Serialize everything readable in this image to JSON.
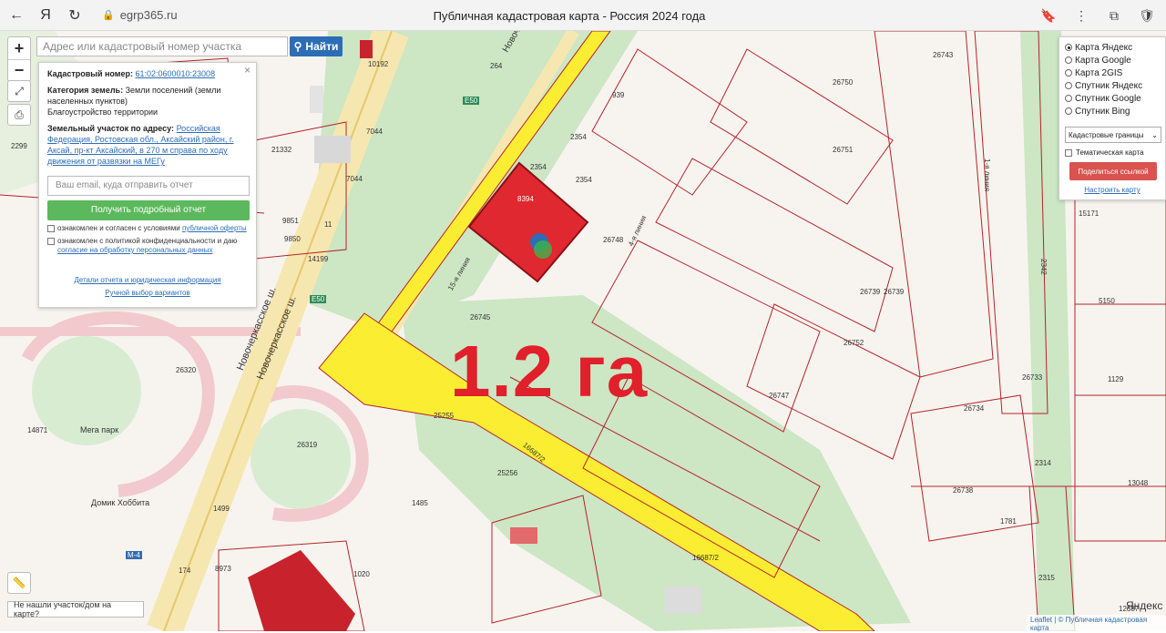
{
  "browser": {
    "back": "←",
    "yandex": "Я",
    "reload": "↻",
    "lock": "🔒",
    "url": "egrp365.ru",
    "tab_title": "Публичная кадастровая карта - Россия 2024 года"
  },
  "map": {
    "zoom_in": "+",
    "zoom_out": "−",
    "search_placeholder": "Адрес или кадастровый номер участка",
    "search_button": "Найти",
    "area_label": "1.2 га",
    "not_found_text": "Не нашли участок/дом на карте?",
    "attribution": "Leaflet | © Публичная кадастровая карта",
    "yandex_logo": "Яндекс",
    "highlighted_parcel": "8394",
    "place_labels": {
      "megapark": "Мега парк",
      "hobbit": "Домик Хоббита",
      "road1": "Новочеркасское ш.",
      "road2": "Новочеркасское ш.",
      "road_top": "Новочерк",
      "e50_top": "E50",
      "e50_mid": "E50",
      "m4": "M-4",
      "line15": "15-я линия",
      "line4": "4-я линия",
      "line1": "1-я линия"
    },
    "parcel_numbers": [
      "10192",
      "264",
      "939",
      "2354",
      "2354",
      "2354",
      "26748",
      "26745",
      "26739",
      "26743",
      "26750",
      "26751",
      "26752",
      "26747",
      "26734",
      "26738",
      "26733",
      "26320",
      "26319",
      "25255",
      "25256",
      "1485",
      "1499",
      "1020",
      "8973",
      "174",
      "14871",
      "7044",
      "7044",
      "21332",
      "9851",
      "9850",
      "14199",
      "2299",
      "1781",
      "2314",
      "2315",
      "12387",
      "13048",
      "5150",
      "15171",
      "1129",
      "16687/2",
      "16687/2",
      "26739",
      "2342",
      "11"
    ]
  },
  "info_panel": {
    "close": "×",
    "cadastral_label": "Кадастровый номер:",
    "cadastral_value": "61:02:0600010:23008",
    "category_label": "Категория земель:",
    "category_value": "Земли поселений (земли населенных пунктов)",
    "category_sub": "Благоустройство территории",
    "address_label": "Земельный участок по адресу:",
    "address_value": "Российская Федерация, Ростовская обл., Аксайский район, г. Аксай, пр-кт Аксайский, в 270 м справа по ходу движения от развязки на МЕГу",
    "email_placeholder": "Ваш email, куда отправить отчет",
    "report_button": "Получить подробный отчет",
    "consent1_text": "ознакомлен и согласен с условиями",
    "consent1_link": "публичной оферты",
    "consent2_text": "ознакомлен с политикой конфиденциальности и даю",
    "consent2_link": "согласие на обработку персональных данных",
    "details_link": "Детали отчета и юридическая информация",
    "manual_link": "Ручной выбор вариантов"
  },
  "layers_panel": {
    "options": [
      {
        "label": "Карта Яндекс",
        "selected": true
      },
      {
        "label": "Карта Google",
        "selected": false
      },
      {
        "label": "Карта 2GIS",
        "selected": false
      },
      {
        "label": "Спутник Яндекс",
        "selected": false
      },
      {
        "label": "Спутник Google",
        "selected": false
      },
      {
        "label": "Спутник Bing",
        "selected": false
      }
    ],
    "boundaries_select": "Кадастровые границы",
    "thematic_label": "Тематическая карта",
    "share_button": "Поделиться ссылкой",
    "configure_link": "Настроить карту"
  },
  "colors": {
    "parcel_line": "#b5232a",
    "highlight": "#e02830",
    "road_yellow": "#fbee32",
    "green_area": "#cde6c4",
    "accent_blue": "#2d6db5"
  }
}
